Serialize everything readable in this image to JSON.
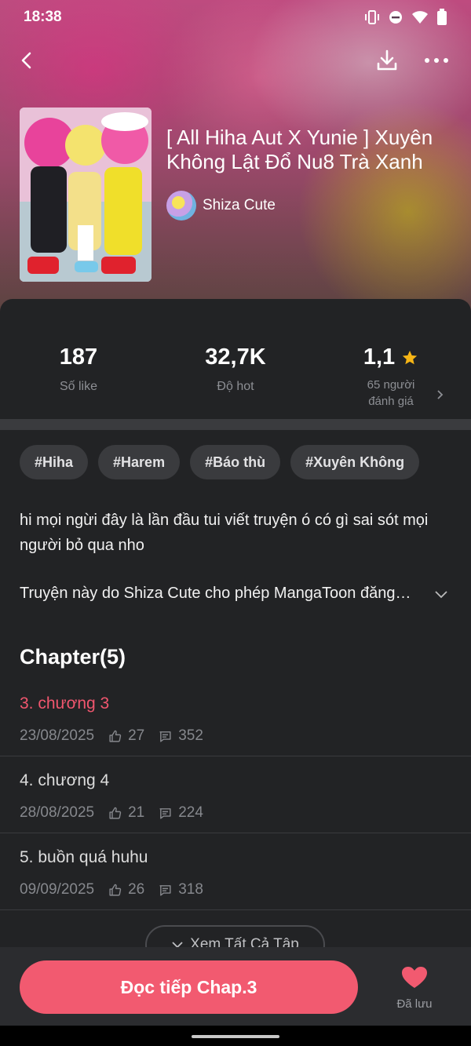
{
  "status_bar": {
    "time": "18:38"
  },
  "story": {
    "title": "[ All Hiha Aut X Yunie ] Xuyên Không Lật Đổ Nu8 Trà Xanh",
    "author": "Shiza Cute"
  },
  "stats": {
    "likes_value": "187",
    "likes_label": "Số like",
    "hot_value": "32,7K",
    "hot_label": "Độ hot",
    "rating_value": "1,1",
    "rating_label_line1": "65 người",
    "rating_label_line2": "đánh giá"
  },
  "tags": [
    "#Hiha",
    "#Harem",
    "#Báo thù",
    "#Xuyên Không"
  ],
  "description": "hi mọi ngừi đây là lần đầu tui viết truyện ó có gì sai sót mọi người bỏ qua nho",
  "permission": "Truyện này do Shiza Cute  cho phép MangaToon đăng…",
  "chapters": {
    "heading": "Chapter(5)",
    "items": [
      {
        "title": "3. chương 3",
        "date": "23/08/2025",
        "likes": "27",
        "comments": "352"
      },
      {
        "title": "4. chương 4",
        "date": "28/08/2025",
        "likes": "21",
        "comments": "224"
      },
      {
        "title": "5. buồn quá huhu",
        "date": "09/09/2025",
        "likes": "26",
        "comments": "318"
      }
    ],
    "view_all": "Xem Tất Cả Tập"
  },
  "bottom": {
    "read_button": "Đọc tiếp Chap.3",
    "saved_label": "Đã lưu"
  },
  "colors": {
    "accent": "#f25a70",
    "background": "#222325",
    "star": "#f6b516"
  },
  "icons": [
    "back-icon",
    "download-icon",
    "more-icon",
    "star-icon",
    "chevron-right-icon",
    "chevron-down-icon",
    "thumb-up-icon",
    "comment-icon",
    "heart-icon"
  ]
}
